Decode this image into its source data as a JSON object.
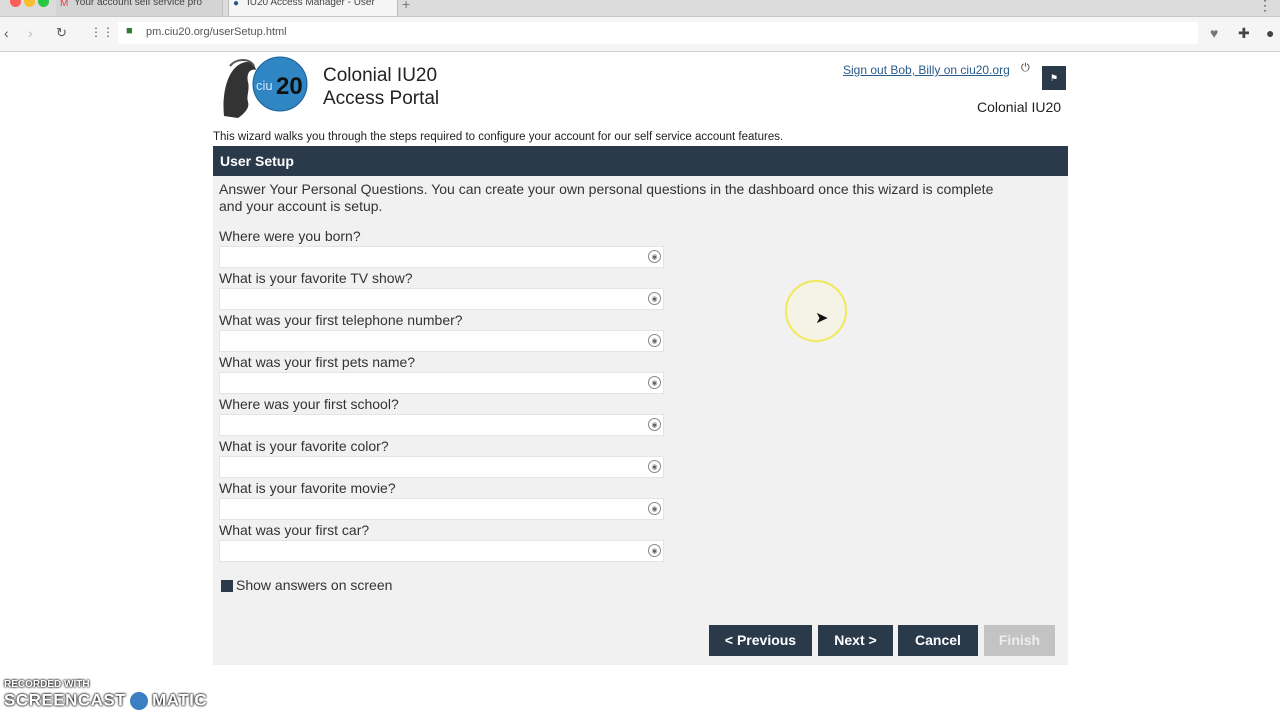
{
  "browser": {
    "tabs": [
      {
        "label": "Your account self service pro"
      },
      {
        "label": "IU20 Access Manager - User"
      }
    ],
    "url": "pm.ciu20.org/userSetup.html"
  },
  "header": {
    "logo_text": "ciu20",
    "title_line1": "Colonial IU20",
    "title_line2": "Access Portal",
    "signout_link": "Sign out Bob, Billy on ciu20.org",
    "org_name": "Colonial IU20"
  },
  "intro": "This wizard walks you through the steps required to configure your account for our self service account features.",
  "panel": {
    "title": "User Setup",
    "instructions": "Answer Your Personal Questions. You can create your own personal questions in the dashboard once this wizard is complete and your account is setup.",
    "questions": [
      {
        "label": "Where were you born?",
        "value": ""
      },
      {
        "label": "What is your favorite TV show?",
        "value": ""
      },
      {
        "label": "What was your first telephone number?",
        "value": ""
      },
      {
        "label": "What was your first pets name?",
        "value": ""
      },
      {
        "label": "Where was your first school?",
        "value": ""
      },
      {
        "label": "What is your favorite color?",
        "value": ""
      },
      {
        "label": "What is your favorite movie?",
        "value": ""
      },
      {
        "label": "What was your first car?",
        "value": ""
      }
    ],
    "show_answers_label": "Show answers on screen",
    "buttons": {
      "previous": "< Previous",
      "next": "Next >",
      "cancel": "Cancel",
      "finish": "Finish"
    }
  },
  "watermark": {
    "line1": "RECORDED WITH",
    "line2a": "SCREENCAST",
    "line2b": "MATIC"
  },
  "colors": {
    "header_bar": "#2b3a4b",
    "panel_bg": "#f1f1f1",
    "link": "#2a5b8a",
    "disabled_button": "#c3c3c3"
  }
}
